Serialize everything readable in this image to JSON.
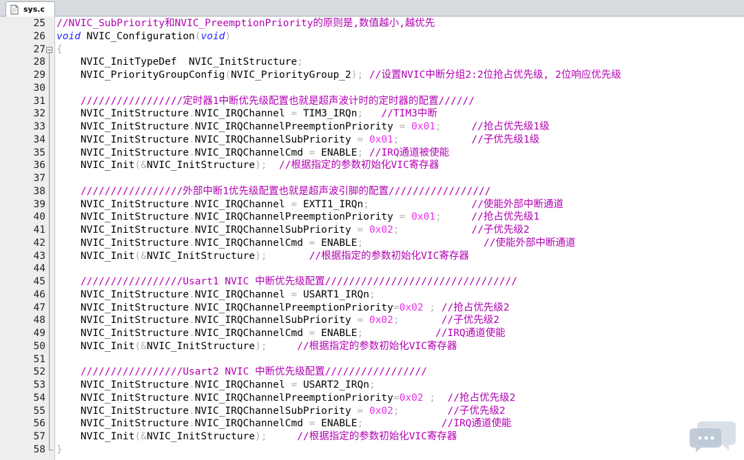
{
  "tab": {
    "label": "sys.c"
  },
  "colors": {
    "comment": "#b200b2",
    "keyword": "#2626ff",
    "punctuation": "#b0b0b0",
    "number": "#e830e8",
    "text": "#000000",
    "gutter": "#eeeeee"
  },
  "icons": {
    "tab": "file-icon",
    "fold": "fold-collapse-icon",
    "watermark": "chat-bubble-icon"
  },
  "lines": [
    {
      "num": "25",
      "tokens": [
        [
          "c",
          "//NVIC_SubPriority和NVIC_PreemptionPriority的原则是,数值越小,越优先"
        ]
      ]
    },
    {
      "num": "26",
      "tokens": [
        [
          "k",
          "void"
        ],
        [
          "t",
          " NVIC_Configuration"
        ],
        [
          "p",
          "("
        ],
        [
          "k",
          "void"
        ],
        [
          "p",
          ")"
        ]
      ]
    },
    {
      "num": "27",
      "tokens": [
        [
          "p",
          "{"
        ]
      ]
    },
    {
      "num": "28",
      "tokens": [
        [
          "t",
          "    NVIC_InitTypeDef  NVIC_InitStructure"
        ],
        [
          "p",
          ";"
        ]
      ]
    },
    {
      "num": "29",
      "tokens": [
        [
          "t",
          "    NVIC_PriorityGroupConfig"
        ],
        [
          "p",
          "("
        ],
        [
          "t",
          "NVIC_PriorityGroup_2"
        ],
        [
          "p",
          ");"
        ],
        [
          "t",
          " "
        ],
        [
          "c",
          "//设置NVIC中断分组2:2位抢占优先级, 2位响应优先级"
        ]
      ]
    },
    {
      "num": "30",
      "tokens": []
    },
    {
      "num": "31",
      "tokens": [
        [
          "t",
          "    "
        ],
        [
          "c",
          "/////////////////定时器1中断优先级配置也就是超声波计时的定时器的配置//////"
        ]
      ]
    },
    {
      "num": "32",
      "tokens": [
        [
          "t",
          "    NVIC_InitStructure"
        ],
        [
          "p",
          "."
        ],
        [
          "t",
          "NVIC_IRQChannel "
        ],
        [
          "p",
          "="
        ],
        [
          "t",
          " TIM3_IRQn"
        ],
        [
          "p",
          ";"
        ],
        [
          "t",
          "   "
        ],
        [
          "c",
          "//TIM3中断"
        ]
      ]
    },
    {
      "num": "33",
      "tokens": [
        [
          "t",
          "    NVIC_InitStructure"
        ],
        [
          "p",
          "."
        ],
        [
          "t",
          "NVIC_IRQChannelPreemptionPriority "
        ],
        [
          "p",
          "="
        ],
        [
          "t",
          " "
        ],
        [
          "n",
          "0x01"
        ],
        [
          "p",
          ";"
        ],
        [
          "t",
          "     "
        ],
        [
          "c",
          "//抢占优先级1级"
        ]
      ]
    },
    {
      "num": "34",
      "tokens": [
        [
          "t",
          "    NVIC_InitStructure"
        ],
        [
          "p",
          "."
        ],
        [
          "t",
          "NVIC_IRQChannelSubPriority "
        ],
        [
          "p",
          "="
        ],
        [
          "t",
          " "
        ],
        [
          "n",
          "0x01"
        ],
        [
          "p",
          ";"
        ],
        [
          "t",
          "            "
        ],
        [
          "c",
          "//子优先级1级"
        ]
      ]
    },
    {
      "num": "35",
      "tokens": [
        [
          "t",
          "    NVIC_InitStructure"
        ],
        [
          "p",
          "."
        ],
        [
          "t",
          "NVIC_IRQChannelCmd "
        ],
        [
          "p",
          "="
        ],
        [
          "t",
          " ENABLE"
        ],
        [
          "p",
          ";"
        ],
        [
          "t",
          " "
        ],
        [
          "c",
          "//IRQ通道被使能"
        ]
      ]
    },
    {
      "num": "36",
      "tokens": [
        [
          "t",
          "    NVIC_Init"
        ],
        [
          "p",
          "(&"
        ],
        [
          "t",
          "NVIC_InitStructure"
        ],
        [
          "p",
          ");"
        ],
        [
          "t",
          "  "
        ],
        [
          "c",
          "//根据指定的参数初始化VIC寄存器"
        ]
      ]
    },
    {
      "num": "37",
      "tokens": []
    },
    {
      "num": "38",
      "tokens": [
        [
          "t",
          "    "
        ],
        [
          "c",
          "/////////////////外部中断1优先级配置也就是超声波引脚的配置/////////////////"
        ]
      ]
    },
    {
      "num": "39",
      "tokens": [
        [
          "t",
          "    NVIC_InitStructure"
        ],
        [
          "p",
          "."
        ],
        [
          "t",
          "NVIC_IRQChannel "
        ],
        [
          "p",
          "="
        ],
        [
          "t",
          " EXTI1_IRQn"
        ],
        [
          "p",
          ";"
        ],
        [
          "t",
          "                 "
        ],
        [
          "c",
          "//使能外部中断通道"
        ]
      ]
    },
    {
      "num": "40",
      "tokens": [
        [
          "t",
          "    NVIC_InitStructure"
        ],
        [
          "p",
          "."
        ],
        [
          "t",
          "NVIC_IRQChannelPreemptionPriority "
        ],
        [
          "p",
          "="
        ],
        [
          "t",
          " "
        ],
        [
          "n",
          "0x01"
        ],
        [
          "p",
          ";"
        ],
        [
          "t",
          "     "
        ],
        [
          "c",
          "//抢占优先级1"
        ]
      ]
    },
    {
      "num": "41",
      "tokens": [
        [
          "t",
          "    NVIC_InitStructure"
        ],
        [
          "p",
          "."
        ],
        [
          "t",
          "NVIC_IRQChannelSubPriority "
        ],
        [
          "p",
          "="
        ],
        [
          "t",
          " "
        ],
        [
          "n",
          "0x02"
        ],
        [
          "p",
          ";"
        ],
        [
          "t",
          "            "
        ],
        [
          "c",
          "//子优先级2"
        ]
      ]
    },
    {
      "num": "42",
      "tokens": [
        [
          "t",
          "    NVIC_InitStructure"
        ],
        [
          "p",
          "."
        ],
        [
          "t",
          "NVIC_IRQChannelCmd "
        ],
        [
          "p",
          "="
        ],
        [
          "t",
          " ENABLE"
        ],
        [
          "p",
          ";"
        ],
        [
          "t",
          "                    "
        ],
        [
          "c",
          "//使能外部中断通道"
        ]
      ]
    },
    {
      "num": "43",
      "tokens": [
        [
          "t",
          "    NVIC_Init"
        ],
        [
          "p",
          "(&"
        ],
        [
          "t",
          "NVIC_InitStructure"
        ],
        [
          "p",
          ");"
        ],
        [
          "t",
          "       "
        ],
        [
          "c",
          "//根据指定的参数初始化VIC寄存器"
        ]
      ]
    },
    {
      "num": "44",
      "tokens": []
    },
    {
      "num": "45",
      "tokens": [
        [
          "t",
          "    "
        ],
        [
          "c",
          "/////////////////Usart1 NVIC 中断优先级配置////////////////////////////////"
        ]
      ]
    },
    {
      "num": "46",
      "tokens": [
        [
          "t",
          "    NVIC_InitStructure"
        ],
        [
          "p",
          "."
        ],
        [
          "t",
          "NVIC_IRQChannel "
        ],
        [
          "p",
          "="
        ],
        [
          "t",
          " USART1_IRQn"
        ],
        [
          "p",
          ";"
        ]
      ]
    },
    {
      "num": "47",
      "tokens": [
        [
          "t",
          "    NVIC_InitStructure"
        ],
        [
          "p",
          "."
        ],
        [
          "t",
          "NVIC_IRQChannelPreemptionPriority"
        ],
        [
          "p",
          "="
        ],
        [
          "n",
          "0x02"
        ],
        [
          "t",
          " "
        ],
        [
          "p",
          ";"
        ],
        [
          "t",
          " "
        ],
        [
          "c",
          "//抢占优先级2"
        ]
      ]
    },
    {
      "num": "48",
      "tokens": [
        [
          "t",
          "    NVIC_InitStructure"
        ],
        [
          "p",
          "."
        ],
        [
          "t",
          "NVIC_IRQChannelSubPriority "
        ],
        [
          "p",
          "="
        ],
        [
          "t",
          " "
        ],
        [
          "n",
          "0x02"
        ],
        [
          "p",
          ";"
        ],
        [
          "t",
          "       "
        ],
        [
          "c",
          "//子优先级2"
        ]
      ]
    },
    {
      "num": "49",
      "tokens": [
        [
          "t",
          "    NVIC_InitStructure"
        ],
        [
          "p",
          "."
        ],
        [
          "t",
          "NVIC_IRQChannelCmd "
        ],
        [
          "p",
          "="
        ],
        [
          "t",
          " ENABLE"
        ],
        [
          "p",
          ";"
        ],
        [
          "t",
          "            "
        ],
        [
          "c",
          "//IRQ通道使能"
        ]
      ]
    },
    {
      "num": "50",
      "tokens": [
        [
          "t",
          "    NVIC_Init"
        ],
        [
          "p",
          "(&"
        ],
        [
          "t",
          "NVIC_InitStructure"
        ],
        [
          "p",
          ");"
        ],
        [
          "t",
          "     "
        ],
        [
          "c",
          "//根据指定的参数初始化VIC寄存器"
        ]
      ]
    },
    {
      "num": "51",
      "tokens": []
    },
    {
      "num": "52",
      "tokens": [
        [
          "t",
          "    "
        ],
        [
          "c",
          "/////////////////Usart2 NVIC 中断优先级配置/////////////////"
        ]
      ]
    },
    {
      "num": "53",
      "tokens": [
        [
          "t",
          "    NVIC_InitStructure"
        ],
        [
          "p",
          "."
        ],
        [
          "t",
          "NVIC_IRQChannel "
        ],
        [
          "p",
          "="
        ],
        [
          "t",
          " USART2_IRQn"
        ],
        [
          "p",
          ";"
        ]
      ]
    },
    {
      "num": "54",
      "tokens": [
        [
          "t",
          "    NVIC_InitStructure"
        ],
        [
          "p",
          "."
        ],
        [
          "t",
          "NVIC_IRQChannelPreemptionPriority"
        ],
        [
          "p",
          "="
        ],
        [
          "n",
          "0x02"
        ],
        [
          "t",
          " "
        ],
        [
          "p",
          ";"
        ],
        [
          "t",
          "  "
        ],
        [
          "c",
          "//抢占优先级2"
        ]
      ]
    },
    {
      "num": "55",
      "tokens": [
        [
          "t",
          "    NVIC_InitStructure"
        ],
        [
          "p",
          "."
        ],
        [
          "t",
          "NVIC_IRQChannelSubPriority "
        ],
        [
          "p",
          "="
        ],
        [
          "t",
          " "
        ],
        [
          "n",
          "0x02"
        ],
        [
          "p",
          ";"
        ],
        [
          "t",
          "        "
        ],
        [
          "c",
          "//子优先级2"
        ]
      ]
    },
    {
      "num": "56",
      "tokens": [
        [
          "t",
          "    NVIC_InitStructure"
        ],
        [
          "p",
          "."
        ],
        [
          "t",
          "NVIC_IRQChannelCmd "
        ],
        [
          "p",
          "="
        ],
        [
          "t",
          " ENABLE"
        ],
        [
          "p",
          ";"
        ],
        [
          "t",
          "             "
        ],
        [
          "c",
          "//IRQ通道使能"
        ]
      ]
    },
    {
      "num": "57",
      "tokens": [
        [
          "t",
          "    NVIC_Init"
        ],
        [
          "p",
          "(&"
        ],
        [
          "t",
          "NVIC_InitStructure"
        ],
        [
          "p",
          ");"
        ],
        [
          "t",
          "     "
        ],
        [
          "c",
          "//根据指定的参数初始化VIC寄存器"
        ]
      ]
    },
    {
      "num": "58",
      "tokens": [
        [
          "p",
          "}"
        ]
      ]
    }
  ]
}
